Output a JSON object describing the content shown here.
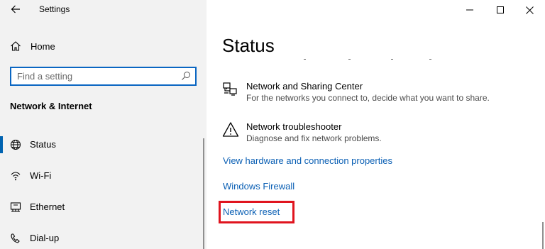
{
  "window": {
    "title": "Settings",
    "controls": [
      "minimize",
      "maximize",
      "close"
    ]
  },
  "sidebar": {
    "home_label": "Home",
    "search_placeholder": "Find a setting",
    "section_title": "Network & Internet",
    "items": [
      {
        "label": "Status",
        "icon": "globe-icon",
        "selected": true
      },
      {
        "label": "Wi-Fi",
        "icon": "wifi-icon",
        "selected": false
      },
      {
        "label": "Ethernet",
        "icon": "ethernet-icon",
        "selected": false
      },
      {
        "label": "Dial-up",
        "icon": "dialup-icon",
        "selected": false
      }
    ]
  },
  "main": {
    "title": "Status",
    "items": [
      {
        "title": "Network and Sharing Center",
        "desc": "For the networks you connect to, decide what you want to share.",
        "icon": "network-sharing-icon"
      },
      {
        "title": "Network troubleshooter",
        "desc": "Diagnose and fix network problems.",
        "icon": "warning-icon"
      }
    ],
    "links": [
      "View hardware and connection properties",
      "Windows Firewall",
      "Network reset"
    ]
  },
  "colors": {
    "accent": "#0063b1",
    "link": "#0a5fb4",
    "highlight_box": "#e0141e",
    "sidebar_bg": "#f2f2f2"
  }
}
